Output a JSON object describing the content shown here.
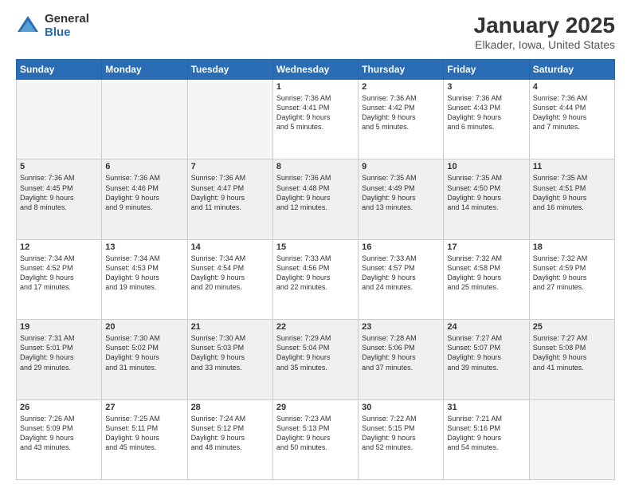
{
  "header": {
    "logo_general": "General",
    "logo_blue": "Blue",
    "month_year": "January 2025",
    "location": "Elkader, Iowa, United States"
  },
  "weekdays": [
    "Sunday",
    "Monday",
    "Tuesday",
    "Wednesday",
    "Thursday",
    "Friday",
    "Saturday"
  ],
  "weeks": [
    [
      {
        "num": "",
        "info": ""
      },
      {
        "num": "",
        "info": ""
      },
      {
        "num": "",
        "info": ""
      },
      {
        "num": "1",
        "info": "Sunrise: 7:36 AM\nSunset: 4:41 PM\nDaylight: 9 hours\nand 5 minutes."
      },
      {
        "num": "2",
        "info": "Sunrise: 7:36 AM\nSunset: 4:42 PM\nDaylight: 9 hours\nand 5 minutes."
      },
      {
        "num": "3",
        "info": "Sunrise: 7:36 AM\nSunset: 4:43 PM\nDaylight: 9 hours\nand 6 minutes."
      },
      {
        "num": "4",
        "info": "Sunrise: 7:36 AM\nSunset: 4:44 PM\nDaylight: 9 hours\nand 7 minutes."
      }
    ],
    [
      {
        "num": "5",
        "info": "Sunrise: 7:36 AM\nSunset: 4:45 PM\nDaylight: 9 hours\nand 8 minutes."
      },
      {
        "num": "6",
        "info": "Sunrise: 7:36 AM\nSunset: 4:46 PM\nDaylight: 9 hours\nand 9 minutes."
      },
      {
        "num": "7",
        "info": "Sunrise: 7:36 AM\nSunset: 4:47 PM\nDaylight: 9 hours\nand 11 minutes."
      },
      {
        "num": "8",
        "info": "Sunrise: 7:36 AM\nSunset: 4:48 PM\nDaylight: 9 hours\nand 12 minutes."
      },
      {
        "num": "9",
        "info": "Sunrise: 7:35 AM\nSunset: 4:49 PM\nDaylight: 9 hours\nand 13 minutes."
      },
      {
        "num": "10",
        "info": "Sunrise: 7:35 AM\nSunset: 4:50 PM\nDaylight: 9 hours\nand 14 minutes."
      },
      {
        "num": "11",
        "info": "Sunrise: 7:35 AM\nSunset: 4:51 PM\nDaylight: 9 hours\nand 16 minutes."
      }
    ],
    [
      {
        "num": "12",
        "info": "Sunrise: 7:34 AM\nSunset: 4:52 PM\nDaylight: 9 hours\nand 17 minutes."
      },
      {
        "num": "13",
        "info": "Sunrise: 7:34 AM\nSunset: 4:53 PM\nDaylight: 9 hours\nand 19 minutes."
      },
      {
        "num": "14",
        "info": "Sunrise: 7:34 AM\nSunset: 4:54 PM\nDaylight: 9 hours\nand 20 minutes."
      },
      {
        "num": "15",
        "info": "Sunrise: 7:33 AM\nSunset: 4:56 PM\nDaylight: 9 hours\nand 22 minutes."
      },
      {
        "num": "16",
        "info": "Sunrise: 7:33 AM\nSunset: 4:57 PM\nDaylight: 9 hours\nand 24 minutes."
      },
      {
        "num": "17",
        "info": "Sunrise: 7:32 AM\nSunset: 4:58 PM\nDaylight: 9 hours\nand 25 minutes."
      },
      {
        "num": "18",
        "info": "Sunrise: 7:32 AM\nSunset: 4:59 PM\nDaylight: 9 hours\nand 27 minutes."
      }
    ],
    [
      {
        "num": "19",
        "info": "Sunrise: 7:31 AM\nSunset: 5:01 PM\nDaylight: 9 hours\nand 29 minutes."
      },
      {
        "num": "20",
        "info": "Sunrise: 7:30 AM\nSunset: 5:02 PM\nDaylight: 9 hours\nand 31 minutes."
      },
      {
        "num": "21",
        "info": "Sunrise: 7:30 AM\nSunset: 5:03 PM\nDaylight: 9 hours\nand 33 minutes."
      },
      {
        "num": "22",
        "info": "Sunrise: 7:29 AM\nSunset: 5:04 PM\nDaylight: 9 hours\nand 35 minutes."
      },
      {
        "num": "23",
        "info": "Sunrise: 7:28 AM\nSunset: 5:06 PM\nDaylight: 9 hours\nand 37 minutes."
      },
      {
        "num": "24",
        "info": "Sunrise: 7:27 AM\nSunset: 5:07 PM\nDaylight: 9 hours\nand 39 minutes."
      },
      {
        "num": "25",
        "info": "Sunrise: 7:27 AM\nSunset: 5:08 PM\nDaylight: 9 hours\nand 41 minutes."
      }
    ],
    [
      {
        "num": "26",
        "info": "Sunrise: 7:26 AM\nSunset: 5:09 PM\nDaylight: 9 hours\nand 43 minutes."
      },
      {
        "num": "27",
        "info": "Sunrise: 7:25 AM\nSunset: 5:11 PM\nDaylight: 9 hours\nand 45 minutes."
      },
      {
        "num": "28",
        "info": "Sunrise: 7:24 AM\nSunset: 5:12 PM\nDaylight: 9 hours\nand 48 minutes."
      },
      {
        "num": "29",
        "info": "Sunrise: 7:23 AM\nSunset: 5:13 PM\nDaylight: 9 hours\nand 50 minutes."
      },
      {
        "num": "30",
        "info": "Sunrise: 7:22 AM\nSunset: 5:15 PM\nDaylight: 9 hours\nand 52 minutes."
      },
      {
        "num": "31",
        "info": "Sunrise: 7:21 AM\nSunset: 5:16 PM\nDaylight: 9 hours\nand 54 minutes."
      },
      {
        "num": "",
        "info": ""
      }
    ]
  ]
}
